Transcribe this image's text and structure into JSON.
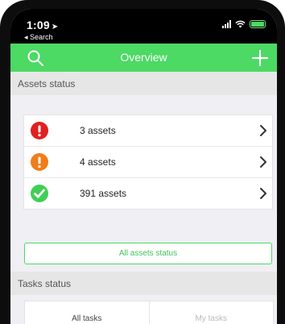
{
  "status_bar": {
    "time": "1:09",
    "back_app": "◂ Search"
  },
  "nav": {
    "title": "Overview",
    "left_icon": "search-icon",
    "right_icon": "plus-icon"
  },
  "sections": {
    "assets_title": "Assets status",
    "tasks_title": "Tasks status"
  },
  "assets": {
    "items": [
      {
        "label": "3 assets",
        "status": "critical",
        "color": "#e02020",
        "icon": "exclamation-icon"
      },
      {
        "label": "4 assets",
        "status": "warning",
        "color": "#ef7d1a",
        "icon": "exclamation-icon"
      },
      {
        "label": "391 assets",
        "status": "ok",
        "color": "#3fcf56",
        "icon": "checkmark-icon"
      }
    ],
    "all_button": "All assets status"
  },
  "tasks": {
    "tabs": [
      {
        "label": "All tasks",
        "active": true
      },
      {
        "label": "My tasks",
        "active": false
      }
    ]
  },
  "colors": {
    "accent": "#4cd964",
    "critical": "#e02020",
    "warning": "#ef7d1a",
    "ok": "#3fcf56"
  }
}
